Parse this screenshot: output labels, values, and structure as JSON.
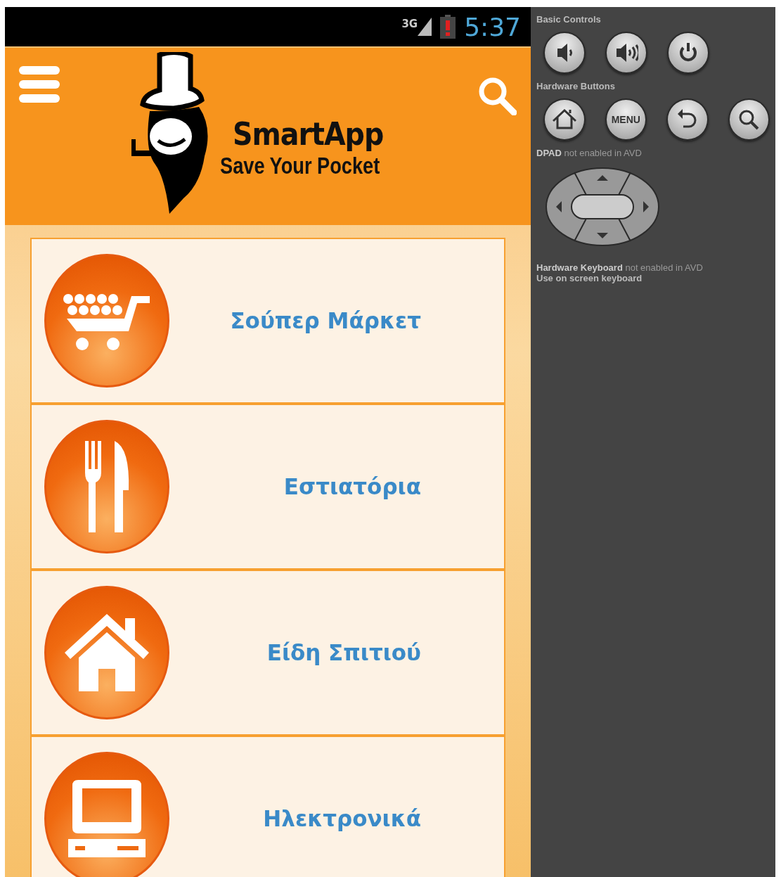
{
  "status_bar": {
    "network": "3G",
    "time": "5:37"
  },
  "app_header": {
    "logo_title": "SmartApp",
    "logo_tagline": "Save Your Pocket"
  },
  "categories": [
    {
      "kind": "cart",
      "label": "Σούπερ Μάρκετ"
    },
    {
      "kind": "cutlery",
      "label": "Εστιατόρια"
    },
    {
      "kind": "house",
      "label": "Είδη Σπιτιού"
    },
    {
      "kind": "computer",
      "label": "Ηλεκτρονικά"
    }
  ],
  "emulator_panel": {
    "basic_controls": {
      "title": "Basic Controls",
      "buttons": [
        {
          "kind": "volume-down"
        },
        {
          "kind": "volume-up"
        },
        {
          "kind": "power"
        }
      ]
    },
    "hardware_buttons": {
      "title": "Hardware Buttons",
      "buttons": [
        {
          "kind": "home"
        },
        {
          "kind": "menu",
          "label": "MENU"
        },
        {
          "kind": "back"
        },
        {
          "kind": "search"
        }
      ]
    },
    "dpad_note": "**DPAD** not enabled in AVD",
    "keyboard_note": "**Hardware Keyboard** not enabled in AVD",
    "keyboard_hint": "Use on screen keyboard"
  }
}
